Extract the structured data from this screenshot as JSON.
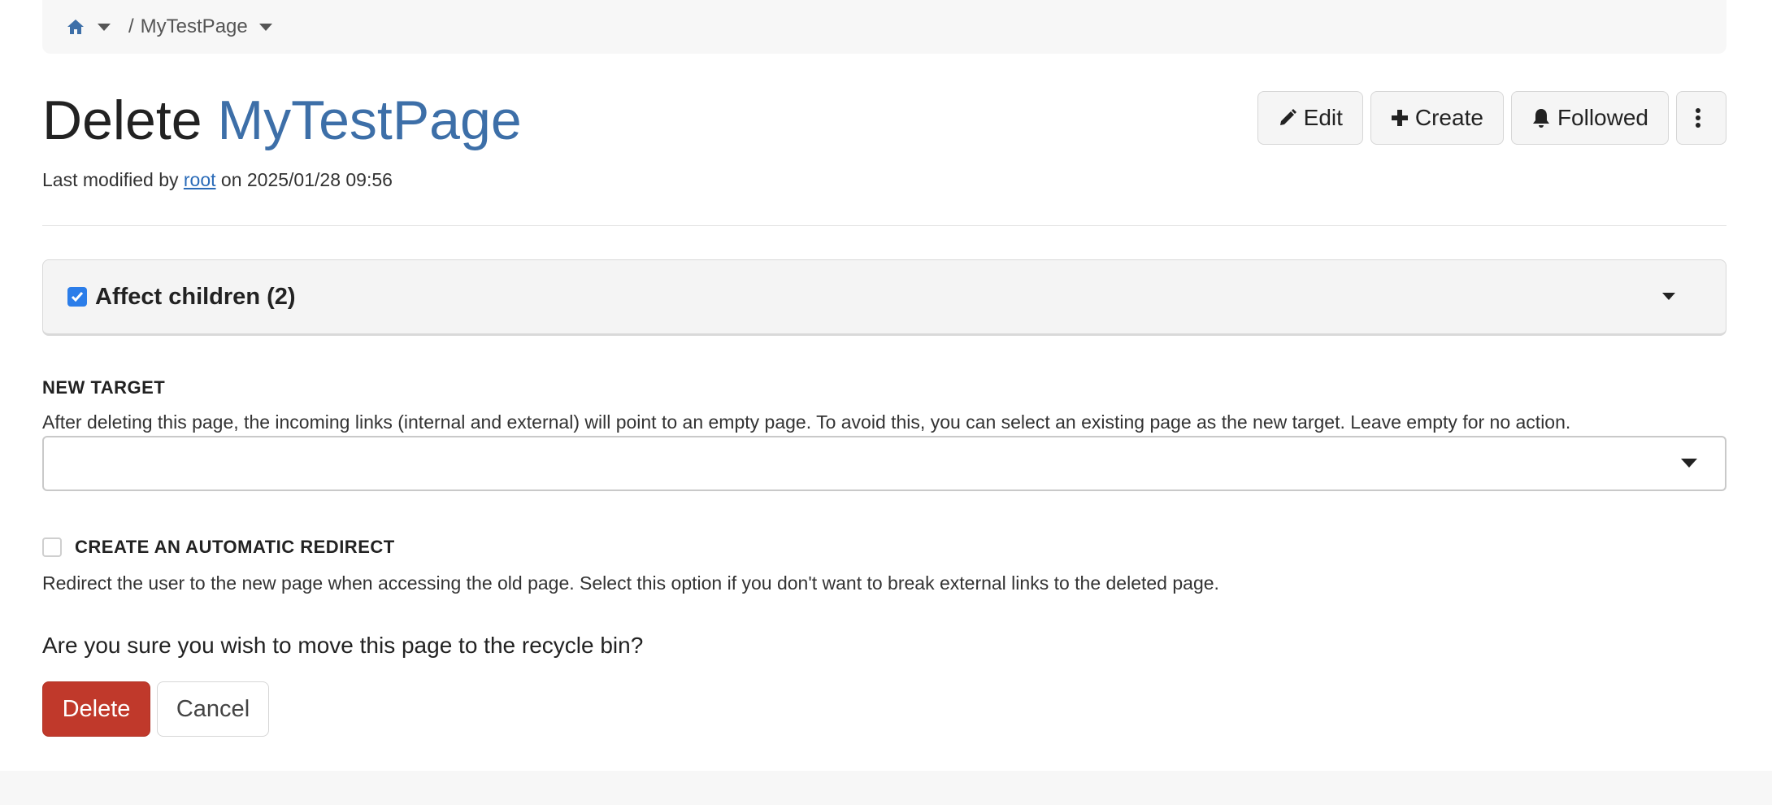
{
  "breadcrumb": {
    "home_icon": "home-icon",
    "separator": "/",
    "page": "MyTestPage"
  },
  "header": {
    "title_prefix": "Delete",
    "title_page": "MyTestPage",
    "modified_prefix": "Last modified by",
    "modified_user": "root",
    "modified_suffix": "on 2025/01/28 09:56"
  },
  "actions": {
    "edit_label": "Edit",
    "create_label": "Create",
    "followed_label": "Followed",
    "edit_icon": "pencil-icon",
    "create_icon": "plus-icon",
    "followed_icon": "bell-icon",
    "more_icon": "kebab-menu-icon"
  },
  "affect_children": {
    "label": "Affect children (2)",
    "checked": true
  },
  "new_target": {
    "label": "NEW TARGET",
    "help": "After deleting this page, the incoming links (internal and external) will point to an empty page. To avoid this, you can select an existing page as the new target. Leave empty for no action.",
    "value": ""
  },
  "redirect": {
    "label": "CREATE AN AUTOMATIC REDIRECT",
    "checked": false,
    "help": "Redirect the user to the new page when accessing the old page. Select this option if you don't want to break external links to the deleted page."
  },
  "confirm_text": "Are you sure you wish to move this page to the recycle bin?",
  "buttons": {
    "delete_label": "Delete",
    "cancel_label": "Cancel"
  },
  "colors": {
    "link": "#3d6fa8",
    "danger": "#c0392b",
    "checkbox": "#2b7de9"
  }
}
